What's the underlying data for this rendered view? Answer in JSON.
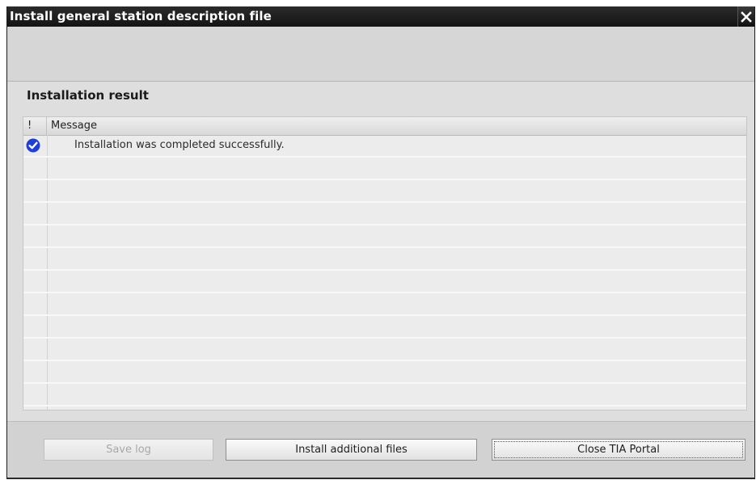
{
  "dialog": {
    "title": "Install general station description file",
    "close_icon": "close-x-icon"
  },
  "result": {
    "section_title": "Installation result",
    "columns": {
      "status": "!",
      "message": "Message"
    },
    "rows": [
      {
        "status_icon": "check-circle-icon",
        "status_color": "#1f3fd6",
        "message": "Installation was completed successfully."
      },
      {
        "status_icon": "",
        "message": ""
      },
      {
        "status_icon": "",
        "message": ""
      },
      {
        "status_icon": "",
        "message": ""
      },
      {
        "status_icon": "",
        "message": ""
      },
      {
        "status_icon": "",
        "message": ""
      },
      {
        "status_icon": "",
        "message": ""
      },
      {
        "status_icon": "",
        "message": ""
      },
      {
        "status_icon": "",
        "message": ""
      },
      {
        "status_icon": "",
        "message": ""
      },
      {
        "status_icon": "",
        "message": ""
      },
      {
        "status_icon": "",
        "message": ""
      }
    ]
  },
  "footer": {
    "save_log_label": "Save log",
    "install_additional_label": "Install additional files",
    "close_portal_label": "Close TIA Portal"
  },
  "colors": {
    "titlebar": "#1a1a1a",
    "dialog_bg": "#dcdcdc",
    "success_blue": "#1f3fd6"
  }
}
